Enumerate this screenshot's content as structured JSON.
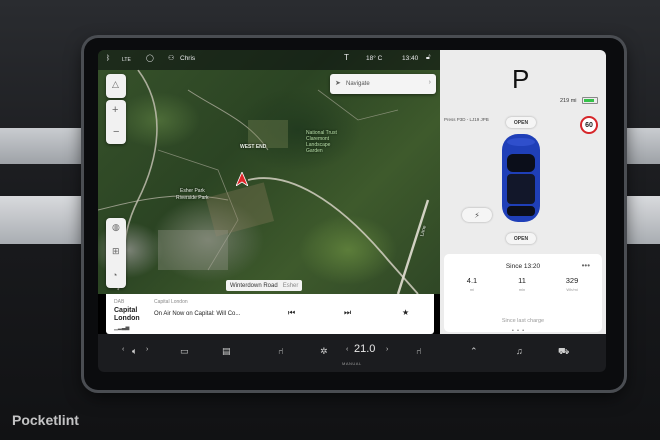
{
  "status_bar": {
    "lte": "LTE",
    "user_name": "Chris",
    "outside_temp": "18° C",
    "clock": "13:40"
  },
  "map": {
    "navigate_placeholder": "Navigate",
    "labels": {
      "west_end": "WEST END",
      "national_trust": "National Trust\nClaremont\nLandscape\nGarden",
      "esher_park": "Esher Park",
      "riverside_park": "Riverside Park",
      "lane": "Lane"
    },
    "current_road": "Winterdown Road",
    "current_area": "Esher"
  },
  "media": {
    "source": "DAB",
    "station_line1": "Capital",
    "station_line2": "London",
    "station_sub": "Capital London",
    "now_playing": "On Air Now on Capital: Will Co..."
  },
  "vehicle": {
    "gear": "P",
    "range": "219 mi",
    "battery_level_pct": 80,
    "profile_text": "Press P3D - LJ19 JPB",
    "speed_limit": "60",
    "frunk_label": "OPEN",
    "trunk_label": "OPEN",
    "car_color": "#1f3fb8"
  },
  "trip": {
    "header": "Since 13:20",
    "menu_glyph": "•••",
    "stats": [
      {
        "value": "4.1",
        "unit": "mi"
      },
      {
        "value": "11",
        "unit": "min"
      },
      {
        "value": "329",
        "unit": "Wh/mi"
      }
    ],
    "footer": "Since last charge"
  },
  "pager": "• • •",
  "bottom_bar": {
    "temperature": "21.0",
    "mode": "MANUAL"
  },
  "watermark": "Pocketlint",
  "colors": {
    "accent_red": "#d6262a",
    "battery_green": "#35c24a",
    "nav_arrow": "#e0262a"
  }
}
